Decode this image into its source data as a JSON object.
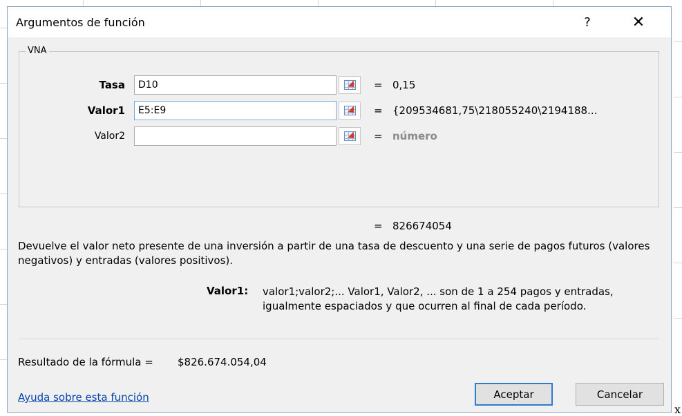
{
  "window": {
    "title": "Argumentos de función",
    "help_glyph": "?",
    "close_glyph": "✕"
  },
  "function_group": {
    "name": "VNA",
    "arguments": [
      {
        "label": "Tasa",
        "value": "D10",
        "result_eq": "=",
        "result": "0,15"
      },
      {
        "label": "Valor1",
        "value": "E5:E9",
        "result_eq": "=",
        "result": "{209534681,75\\218055240\\2194188..."
      },
      {
        "label": "Valor2",
        "value": "",
        "result_eq": "=",
        "result": "número"
      }
    ]
  },
  "result": {
    "eq": "=",
    "value": "826674054"
  },
  "description": "Devuelve el valor neto presente de una inversión a partir de una tasa de descuento y una serie de pagos futuros (valores negativos) y entradas (valores positivos).",
  "parameter_help": {
    "name": "Valor1:",
    "text": "valor1;valor2;... Valor1, Valor2, ... son de 1 a 254 pagos y entradas, igualmente espaciados y que ocurren al final de cada período."
  },
  "formula_result": {
    "label": "Resultado de la fórmula =",
    "value": "$826.674.054,04"
  },
  "help_link": "Ayuda sobre esta función",
  "buttons": {
    "ok": "Aceptar",
    "cancel": "Cancelar"
  },
  "stray_text": "x",
  "icons": {
    "ref_button": "collapse-dialog-icon"
  }
}
